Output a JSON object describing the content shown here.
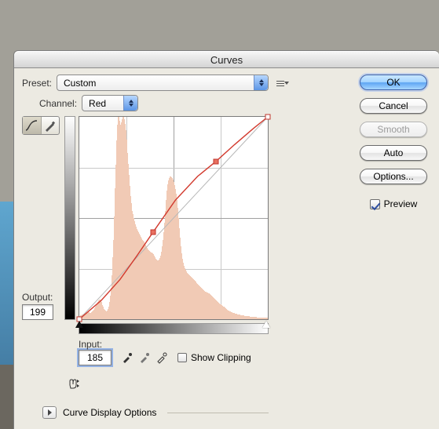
{
  "title": "Curves",
  "preset": {
    "label": "Preset:",
    "value": "Custom"
  },
  "channel": {
    "label": "Channel:",
    "value": "Red"
  },
  "buttons": {
    "ok": "OK",
    "cancel": "Cancel",
    "smooth": "Smooth",
    "auto": "Auto",
    "options": "Options..."
  },
  "preview": {
    "label": "Preview",
    "checked": true
  },
  "output": {
    "label": "Output:",
    "value": "199"
  },
  "input": {
    "label": "Input:",
    "value": "185"
  },
  "show_clipping": {
    "label": "Show Clipping",
    "checked": false
  },
  "disclosure": {
    "label": "Curve Display Options"
  },
  "chart_data": {
    "type": "line",
    "title": "",
    "xlabel": "Input",
    "ylabel": "Output",
    "xlim": [
      0,
      255
    ],
    "ylim": [
      0,
      255
    ],
    "series": [
      {
        "name": "Baseline",
        "points": [
          [
            0,
            0
          ],
          [
            255,
            255
          ]
        ]
      },
      {
        "name": "Red channel curve",
        "points": [
          [
            0,
            0
          ],
          [
            30,
            24
          ],
          [
            55,
            50
          ],
          [
            78,
            80
          ],
          [
            100,
            110
          ],
          [
            130,
            150
          ],
          [
            160,
            180
          ],
          [
            185,
            199
          ],
          [
            210,
            220
          ],
          [
            235,
            240
          ],
          [
            255,
            255
          ]
        ],
        "control_points": [
          [
            0,
            0
          ],
          [
            100,
            110
          ],
          [
            185,
            199
          ],
          [
            255,
            255
          ]
        ]
      }
    ],
    "histogram_channel": "Red",
    "histogram": [
      4,
      5,
      5,
      6,
      6,
      7,
      7,
      7,
      8,
      8,
      8,
      9,
      9,
      8,
      8,
      9,
      10,
      11,
      12,
      14,
      16,
      18,
      20,
      22,
      24,
      25,
      25,
      24,
      22,
      18,
      16,
      13,
      12,
      11,
      10,
      11,
      13,
      16,
      22,
      30,
      40,
      55,
      78,
      100,
      130,
      165,
      195,
      225,
      245,
      255,
      255,
      250,
      245,
      248,
      252,
      255,
      255,
      252,
      246,
      238,
      226,
      210,
      196,
      182,
      168,
      155,
      146,
      140,
      136,
      132,
      128,
      124,
      120,
      117,
      114,
      112,
      110,
      108,
      106,
      104,
      102,
      100,
      99,
      98,
      96,
      94,
      92,
      90,
      88,
      87,
      86,
      85,
      84,
      84,
      83,
      82,
      80,
      78,
      76,
      75,
      74,
      74,
      75,
      77,
      80,
      85,
      92,
      100,
      110,
      122,
      136,
      150,
      162,
      170,
      175,
      178,
      180,
      180,
      179,
      178,
      176,
      173,
      169,
      164,
      158,
      150,
      140,
      128,
      115,
      103,
      92,
      83,
      76,
      71,
      67,
      64,
      62,
      60,
      58,
      57,
      56,
      55,
      54,
      53,
      52,
      51,
      50,
      49,
      48,
      47,
      46,
      45,
      44,
      43,
      42,
      41,
      40,
      39,
      38,
      37,
      36,
      35,
      35,
      34,
      34,
      33,
      33,
      32,
      31,
      30,
      29,
      28,
      27,
      26,
      25,
      24,
      23,
      22,
      21,
      20,
      19,
      19,
      18,
      17,
      16,
      16,
      15,
      14,
      13,
      13,
      12,
      11,
      11,
      10,
      10,
      9,
      9,
      8,
      8,
      8,
      7,
      7,
      7,
      6,
      6,
      6,
      6,
      5,
      5,
      5,
      5,
      5,
      4,
      4,
      4,
      4,
      4,
      4,
      4,
      3,
      3,
      3,
      3,
      3,
      3,
      3,
      3,
      3,
      2,
      2,
      2,
      2,
      2,
      2,
      2,
      2,
      2,
      2,
      2,
      2,
      2,
      2
    ]
  }
}
